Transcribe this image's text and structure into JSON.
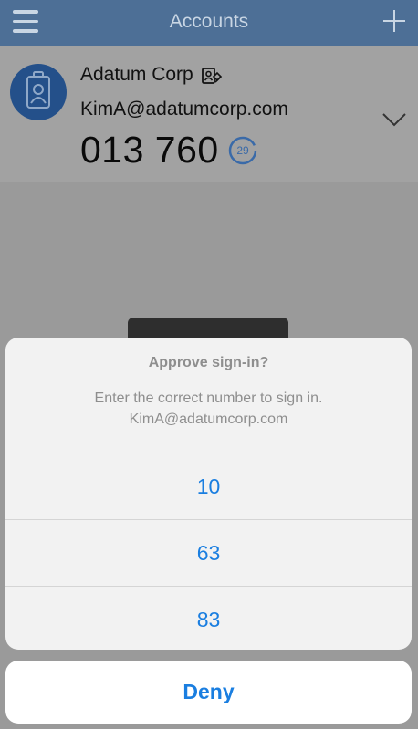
{
  "navbar": {
    "title": "Accounts",
    "menu_icon": "hamburger-menu-icon",
    "add_icon": "plus-icon"
  },
  "account": {
    "name": "Adatum Corp",
    "email": "KimA@adatumcorp.com",
    "code": "013 760",
    "timer_seconds": "29",
    "avatar_icon": "id-badge-icon",
    "managed_icon": "managed-account-icon",
    "expand_icon": "chevron-down-icon"
  },
  "dialog": {
    "title": "Approve sign-in?",
    "message_line1": "Enter the correct number to sign in.",
    "message_line2": "KimA@adatumcorp.com",
    "options": [
      "10",
      "63",
      "83"
    ],
    "deny_label": "Deny"
  },
  "colors": {
    "navbar": "#4d6f96",
    "accent": "#1a7ee0",
    "avatar": "#24508a"
  }
}
